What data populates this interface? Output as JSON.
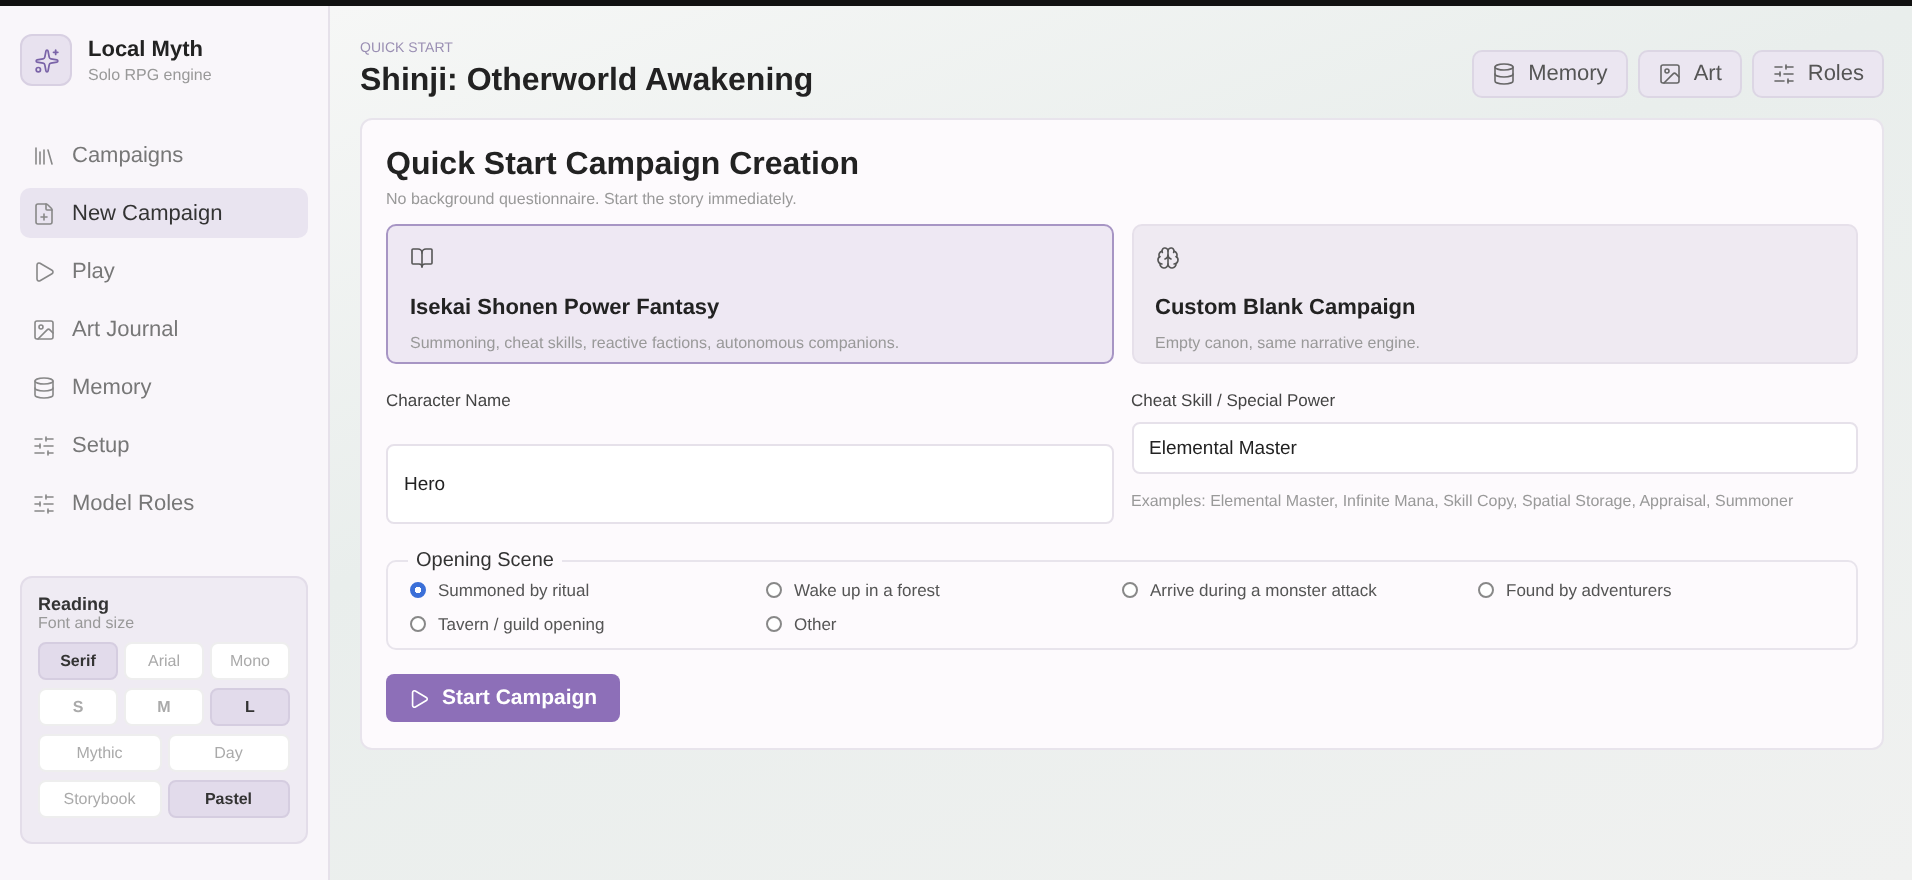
{
  "app": {
    "name": "Local Myth",
    "tagline": "Solo RPG engine"
  },
  "nav": [
    {
      "label": "Campaigns",
      "selected": false
    },
    {
      "label": "New Campaign",
      "selected": true
    },
    {
      "label": "Play",
      "selected": false
    },
    {
      "label": "Art Journal",
      "selected": false
    },
    {
      "label": "Memory",
      "selected": false
    },
    {
      "label": "Setup",
      "selected": false
    },
    {
      "label": "Model Roles",
      "selected": false
    }
  ],
  "reading": {
    "title": "Reading",
    "subtitle": "Font and size",
    "groups": [
      [
        {
          "label": "Serif",
          "selected": true
        },
        {
          "label": "Arial",
          "selected": false
        },
        {
          "label": "Mono",
          "selected": false
        }
      ],
      [
        {
          "label": "S",
          "selected": false
        },
        {
          "label": "M",
          "selected": false
        },
        {
          "label": "L",
          "selected": true
        }
      ],
      [
        {
          "label": "Mythic",
          "selected": false
        },
        {
          "label": "Day",
          "selected": false
        }
      ],
      [
        {
          "label": "Storybook",
          "selected": false
        },
        {
          "label": "Pastel",
          "selected": true
        }
      ]
    ]
  },
  "header": {
    "eyebrow": "QUICK START",
    "title": "Shinji: Otherworld Awakening",
    "actions": [
      "Memory",
      "Art",
      "Roles"
    ]
  },
  "form": {
    "title": "Quick Start Campaign Creation",
    "subtitle": "No background questionnaire. Start the story immediately.",
    "templates": [
      {
        "title": "Isekai Shonen Power Fantasy",
        "description": "Summoning, cheat skills, reactive factions, autonomous companions.",
        "selected": true
      },
      {
        "title": "Custom Blank Campaign",
        "description": "Empty canon, same narrative engine.",
        "selected": false
      }
    ],
    "character_name": {
      "label": "Character Name",
      "value": "Hero"
    },
    "cheat_skill": {
      "label": "Cheat Skill / Special Power",
      "value": "Elemental Master",
      "hint": "Examples: Elemental Master, Infinite Mana, Skill Copy, Spatial Storage, Appraisal, Summoner"
    },
    "opening_scene": {
      "legend": "Opening Scene",
      "options": [
        {
          "label": "Summoned by ritual",
          "selected": true
        },
        {
          "label": "Wake up in a forest",
          "selected": false
        },
        {
          "label": "Arrive during a monster attack",
          "selected": false
        },
        {
          "label": "Found by adventurers",
          "selected": false
        },
        {
          "label": "Tavern / guild opening",
          "selected": false
        },
        {
          "label": "Other",
          "selected": false
        }
      ]
    },
    "submit": "Start Campaign"
  }
}
